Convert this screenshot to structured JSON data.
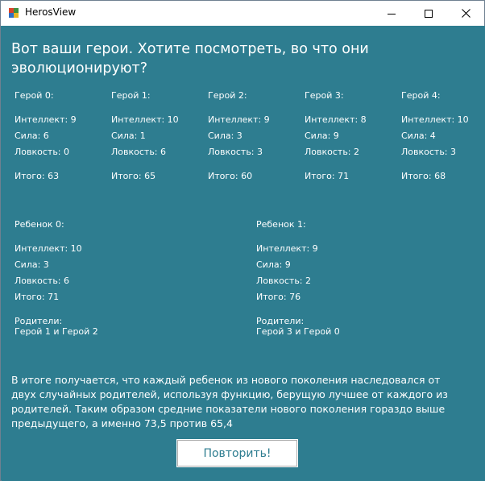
{
  "window": {
    "title": "HerosView",
    "controls": {
      "minimize": "minimize",
      "maximize": "maximize",
      "close": "close"
    }
  },
  "heading": "Вот ваши герои. Хотите посмотреть, во что они эволюционируют?",
  "heroes": [
    {
      "title": "Герой 0:",
      "intellect": "Интеллект: 9",
      "strength": "Сила: 6",
      "agility": "Ловкость: 0",
      "total": "Итого: 63"
    },
    {
      "title": "Герой 1:",
      "intellect": "Интеллект: 10",
      "strength": "Сила: 1",
      "agility": "Ловкость: 6",
      "total": "Итого: 65"
    },
    {
      "title": "Герой 2:",
      "intellect": "Интеллект: 9",
      "strength": "Сила: 3",
      "agility": "Ловкость: 3",
      "total": "Итого: 60"
    },
    {
      "title": "Герой 3:",
      "intellect": "Интеллект: 8",
      "strength": "Сила: 9",
      "agility": "Ловкость: 2",
      "total": "Итого: 71"
    },
    {
      "title": "Герой 4:",
      "intellect": "Интеллект: 10",
      "strength": "Сила: 4",
      "agility": "Ловкость: 3",
      "total": "Итого: 68"
    }
  ],
  "children": [
    {
      "title": "Ребенок 0:",
      "intellect": "Интеллект: 10",
      "strength": "Сила: 3",
      "agility": "Ловкость: 6",
      "total": "Итого: 71",
      "parents_label": "Родители:",
      "parents": "Герой 1 и Герой 2"
    },
    {
      "title": "Ребенок 1:",
      "intellect": "Интеллект: 9",
      "strength": "Сила: 9",
      "agility": "Ловкость: 2",
      "total": "Итого: 76",
      "parents_label": "Родители:",
      "parents": "Герой 3 и Герой 0"
    }
  ],
  "summary": "В итоге получается, что каждый ребенок из нового поколения наследовался от двух случайных родителей, используя функцию, берущую лучшее от каждого из родителей. Таким образом средние показатели нового поколения гораздо выше предыдущего, а именно 73,5 против 65,4",
  "repeat_button": "Повторить!",
  "colors": {
    "background": "#2e7d90",
    "text": "#ffffff",
    "titlebar": "#ffffff"
  }
}
